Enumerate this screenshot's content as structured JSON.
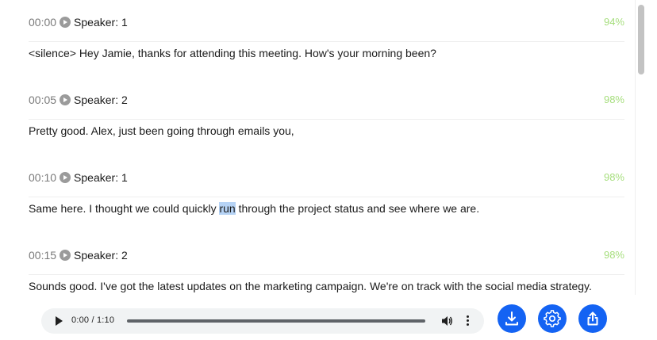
{
  "transcript": {
    "segments": [
      {
        "time": "00:00",
        "speaker": "Speaker: 1",
        "confidence": "94%",
        "text": "<silence> Hey Jamie, thanks for attending this meeting. How's your morning been?"
      },
      {
        "time": "00:05",
        "speaker": "Speaker: 2",
        "confidence": "98%",
        "text": "Pretty good. Alex, just been going through emails you,"
      },
      {
        "time": "00:10",
        "speaker": "Speaker: 1",
        "confidence": "98%",
        "text_before": "Same here. I thought we could quickly ",
        "text_highlight": "run",
        "text_after": " through the project status and see where we are."
      },
      {
        "time": "00:15",
        "speaker": "Speaker: 2",
        "confidence": "98%",
        "text": "Sounds good. I've got the latest updates on the marketing campaign. We're on track with the social media strategy."
      }
    ]
  },
  "player": {
    "time_display": "0:00 / 1:10",
    "progress": 0.0
  },
  "actions": {
    "icons": [
      "download-icon",
      "gear-icon",
      "share-icon"
    ]
  },
  "colors": {
    "accent": "#1463f3",
    "confidence": "#a6de7d",
    "highlight": "#b6d3f5"
  }
}
